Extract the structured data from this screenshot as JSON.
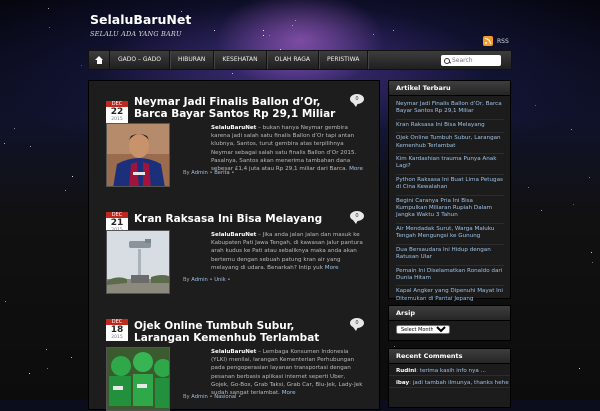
{
  "site": {
    "title": "SelaluBaruNet",
    "description": "SELALU ADA YANG BARU",
    "rss_label": "RSS"
  },
  "nav": {
    "items": [
      "GADO – GADO",
      "HIBURAN",
      "KESEHATAN",
      "OLAH RAGA",
      "PERISTIWA"
    ],
    "search_placeholder": "Search"
  },
  "posts": [
    {
      "month": "DEC",
      "day": "22",
      "year": "2015",
      "title": "Neymar Jadi Finalis Ballon d’Or, Barca Bayar Santos Rp 29,1 Miliar",
      "comments": "0",
      "author_lead": "SelaluBaruNet",
      "excerpt": " – bukan hanya Neymar gembira karena jadi salah satu finalis Ballon d’Or tapi antan klubnya, Santos, turut gembira atas terpilihnya Neymar sebagai salah satu finalis Ballon d’Or 2015. Pasalnya, Santos akan menerima tambahan dana sebesar £1,4 juta atau Rp 29,1 miliar dari Barca.",
      "more": "More",
      "meta_by": "By",
      "meta_author": "Admin",
      "meta_cat": "Berita"
    },
    {
      "month": "DEC",
      "day": "21",
      "year": "2015",
      "title": "Kran Raksasa Ini Bisa Melayang",
      "comments": "0",
      "author_lead": "SelaluBaruNet",
      "excerpt": " – Jika anda jalan jalan dan masuk ke Kabupaten Pati Jawa Tengah, di kawasan jalur pantura arah kudus ke Pati atau sebaliknya maka anda akan bertemu dengan sebuah patung kran air yang melayang di udara. Benarkah? Intip yuk",
      "more": "More",
      "meta_by": "By",
      "meta_author": "Admin",
      "meta_cat": "Unik"
    },
    {
      "month": "DEC",
      "day": "18",
      "year": "2015",
      "title": "Ojek Online Tumbuh Subur, Larangan Kemenhub Terlambat",
      "comments": "0",
      "author_lead": "SelaluBaruNet",
      "excerpt": " – Lembaga Konsumen Indonesia (YLKI) menilai, larangan Kementerian Perhubungan pada pengoperasian layanan transportasi dengan pesanan berbasis aplikasi internet seperti Uber, Gojek, Go-Box, Grab Taksi, Grab Car, Blu-Jek, Lady-Jek sudah sangat terlambat.",
      "more": "More",
      "meta_by": "By",
      "meta_author": "Admin",
      "meta_cat": "Nasional"
    }
  ],
  "sidebar": {
    "recent_title": "Artikel Terbaru",
    "recent": [
      "Neymar Jadi Finalis Ballon d’Or, Barca Bayar Santos Rp 29,1 Miliar",
      "Kran Raksasa Ini Bisa Melayang",
      "Ojek Online Tumbuh Subur, Larangan Kemenhub Terlambat",
      "Kim Kardashian trauma Punya Anak Lagi?",
      "Python Raksasa Ini Buat Lima Petugas di Cina Kewalahan",
      "Begini Caranya Pria Ini Bisa Kumpulkan Miliaran Rupiah Dalam Jangka Waktu 3 Tahun",
      "Air Mendadak Surut, Warga Maluku Tengah Mengungsi ke Gunung",
      "Dua Bersaudara Ini Hidup dengan Ratusan Ular",
      "Pemain Ini Diselamatkan Ronaldo dari Dunia Hitam",
      "Kapal Angker yang Dipenuhi Mayat Ini Ditemukan di Pantai Jepang"
    ],
    "archive_title": "Arsip",
    "archive_select": "Select Month",
    "comments_title": "Recent Comments",
    "comments": [
      {
        "who": "Rudini",
        "text": ": terima kasih info nya ..."
      },
      {
        "who": "ibay",
        "text": ": jadi tambah ilmunya, thanks hehe"
      }
    ]
  }
}
